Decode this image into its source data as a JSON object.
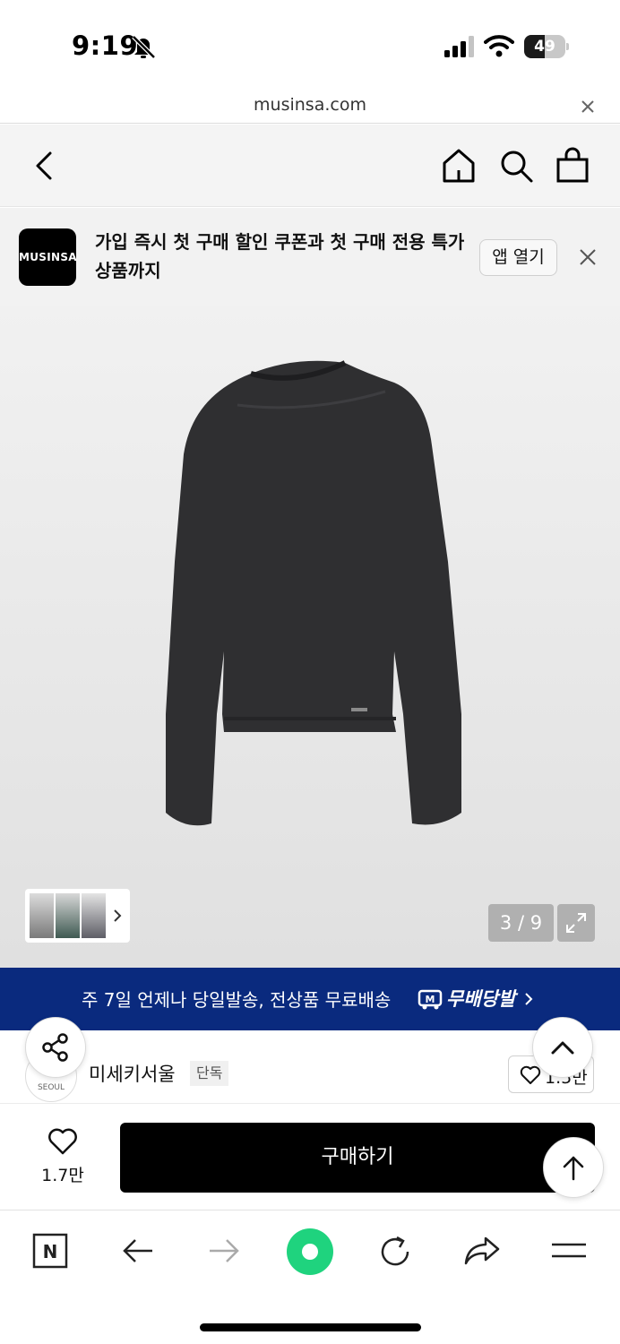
{
  "status_bar": {
    "time": "9:19",
    "battery_level": "49",
    "icons": [
      "bell-slash-icon",
      "signal-icon",
      "wifi-icon",
      "battery-icon"
    ]
  },
  "browser": {
    "url": "musinsa.com"
  },
  "app_header": {
    "icons": [
      "back-icon",
      "home-icon",
      "search-icon",
      "shopping-bag-icon"
    ]
  },
  "banner": {
    "logo_text": "MUSINSA",
    "message": "가입 즉시 첫 구매 할인 쿠폰과 첫 구매 전용 특가 상품까지",
    "open_app_label": "앱 열기"
  },
  "gallery": {
    "page_counter": "3 / 9",
    "current_page": 3,
    "total_pages": 9,
    "thumbnail_count": 3,
    "product_color": "#2f2f31"
  },
  "shipping": {
    "text": "주 7일 언제나 당일발송, 전상품 무료배송",
    "brand_label": "무배당발"
  },
  "brand": {
    "avatar_text": "SEOUL",
    "name": "미세키서울",
    "badge": "단독",
    "like_count": "1.5만"
  },
  "purchase": {
    "wish_count": "1.7만",
    "buy_label": "구매하기"
  },
  "colors": {
    "shipping_banner": "#0a2a7e",
    "buy_button": "#000000",
    "browser_green": "#1fd37e"
  }
}
